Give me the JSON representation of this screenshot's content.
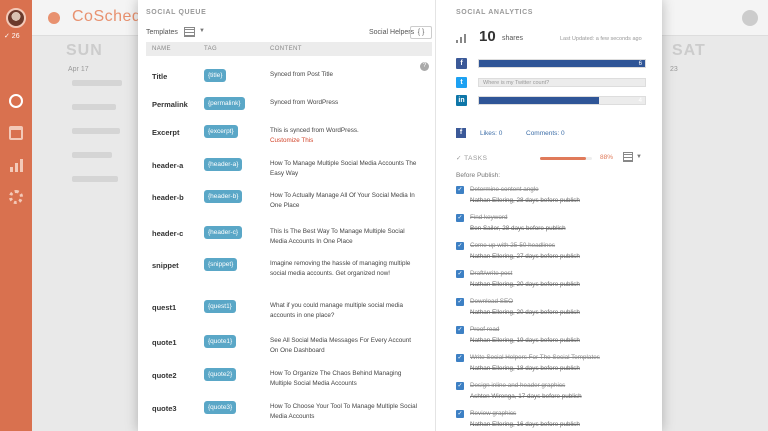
{
  "app": {
    "brand": "CoSchedule",
    "check_count": "✓ 26",
    "accent": "#d9714f",
    "bg_day_left": "SUN",
    "bg_day_right": "SAT",
    "bg_date_left": "Apr 17",
    "bg_date_right": "23"
  },
  "queue": {
    "title": "SOCIAL QUEUE",
    "templates_label": "Templates",
    "helpers_label": "Social Helpers",
    "braces_label": "{ }",
    "columns": {
      "name": "NAME",
      "tag": "TAG",
      "content": "CONTENT"
    },
    "help": "?",
    "rows": [
      {
        "name": "Title",
        "tag": "{title}",
        "content": "Synced from Post Title"
      },
      {
        "name": "Permalink",
        "tag": "{permalink}",
        "content": "Synced from WordPress"
      },
      {
        "name": "Excerpt",
        "tag": "{excerpt}",
        "content": "This is synced from WordPress.",
        "extra": "Customize This"
      },
      {
        "name": "header-a",
        "tag": "{header-a}",
        "content": "How To Manage Multiple Social Media Accounts The Easy Way"
      },
      {
        "name": "header-b",
        "tag": "{header-b}",
        "content": "How To Actually Manage All Of Your Social Media In One Place"
      },
      {
        "name": "header-c",
        "tag": "{header-c}",
        "content": "This Is The Best Way To Manage Multiple Social Media Accounts In One Place"
      },
      {
        "name": "snippet",
        "tag": "{snippet}",
        "content": "Imagine removing the hassle of managing multiple social media accounts. Get organized now!"
      },
      {
        "name": "quest1",
        "tag": "{quest1}",
        "content": "What if you could manage multiple social media accounts in one place?"
      },
      {
        "name": "quote1",
        "tag": "{quote1}",
        "content": "See All Social Media Messages For Every Account On One Dashboard"
      },
      {
        "name": "quote2",
        "tag": "{quote2}",
        "content": "How To Organize The Chaos Behind Managing Multiple Social Media Accounts"
      },
      {
        "name": "quote3",
        "tag": "{quote3}",
        "content": "How To Choose Your Tool To Manage Multiple Social Media Accounts"
      }
    ]
  },
  "analytics": {
    "title": "SOCIAL ANALYTICS",
    "shares_count": "10",
    "shares_label": "shares",
    "last_updated": "Last Updated: a few seconds ago",
    "networks": [
      {
        "icon": "f",
        "name": "facebook",
        "color": "#3b5998",
        "count": "6",
        "fill_fraction": 1.0,
        "placeholder": ""
      },
      {
        "icon": "t",
        "name": "twitter",
        "color": "#1da1f2",
        "count": "",
        "fill_fraction": 0,
        "placeholder": "Where is my Twitter count?"
      },
      {
        "icon": "in",
        "name": "linkedin",
        "color": "#0e76a8",
        "count": "4",
        "fill_fraction": 0.72,
        "placeholder": ""
      }
    ],
    "fb_icon": "f",
    "likes": "Likes: 0",
    "comments": "Comments: 0"
  },
  "tasks": {
    "label": "✓ TASKS",
    "percent_text": "88%",
    "percent": 88,
    "group_label": "Before Publish:",
    "items": [
      {
        "title": "Determine content angle",
        "meta": "Nathan Ellering, 28 days before publish"
      },
      {
        "title": "Find keyword",
        "meta": "Ben Sailer, 28 days before publish"
      },
      {
        "title": "Come up with 25-50 headlines",
        "meta": "Nathan Ellering, 27 days before publish"
      },
      {
        "title": "Draft/write post",
        "meta": "Nathan Ellering, 20 days before publish"
      },
      {
        "title": "Download SEO",
        "meta": "Nathan Ellering, 20 days before publish"
      },
      {
        "title": "Proof read",
        "meta": "Nathan Ellering, 19 days before publish"
      },
      {
        "title": "Write Social Helpers For The Social Templates",
        "meta": "Nathan Ellering, 18 days before publish"
      },
      {
        "title": "Design inline and header graphics",
        "meta": "Ashton Wirenga, 17 days before publish"
      },
      {
        "title": "Review graphics",
        "meta": "Nathan Ellering, 16 days before publish"
      }
    ]
  }
}
